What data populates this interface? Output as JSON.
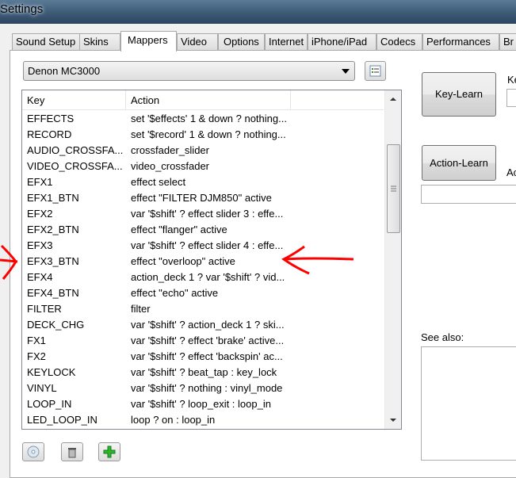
{
  "window": {
    "title": "Settings"
  },
  "tabs": [
    {
      "label": "Sound Setup"
    },
    {
      "label": "Skins"
    },
    {
      "label": "Mappers",
      "active": true
    },
    {
      "label": "Video"
    },
    {
      "label": "Options"
    },
    {
      "label": "Internet"
    },
    {
      "label": "iPhone/iPad"
    },
    {
      "label": "Codecs"
    },
    {
      "label": "Performances"
    },
    {
      "label": "Br"
    }
  ],
  "mapper": {
    "selected": "Denon MC3000"
  },
  "table": {
    "columns": [
      "Key",
      "Action"
    ],
    "rows": [
      {
        "key": "EFFECTS",
        "action": "set '$effects' 1 & down ? nothing..."
      },
      {
        "key": "RECORD",
        "action": "set '$record' 1 & down ? nothing..."
      },
      {
        "key": "AUDIO_CROSSFA...",
        "action": "crossfader_slider"
      },
      {
        "key": "VIDEO_CROSSFA...",
        "action": "video_crossfader"
      },
      {
        "key": "EFX1",
        "action": "effect select"
      },
      {
        "key": "EFX1_BTN",
        "action": "effect \"FILTER DJM850\" active"
      },
      {
        "key": "EFX2",
        "action": "var '$shift' ? effect slider 3 : effe..."
      },
      {
        "key": "EFX2_BTN",
        "action": "effect \"flanger\" active"
      },
      {
        "key": "EFX3",
        "action": "var '$shift' ? effect slider 4 : effe..."
      },
      {
        "key": "EFX3_BTN",
        "action": "effect \"overloop\" active"
      },
      {
        "key": "EFX4",
        "action": "action_deck 1 ? var '$shift' ? vid..."
      },
      {
        "key": "EFX4_BTN",
        "action": "effect \"echo\" active"
      },
      {
        "key": "FILTER",
        "action": "filter"
      },
      {
        "key": "DECK_CHG",
        "action": "var '$shift' ? action_deck 1 ? ski..."
      },
      {
        "key": "FX1",
        "action": "var '$shift' ? effect 'brake' active..."
      },
      {
        "key": "FX2",
        "action": "var '$shift' ? effect 'backspin' ac..."
      },
      {
        "key": "KEYLOCK",
        "action": "var '$shift' ? beat_tap : key_lock"
      },
      {
        "key": "VINYL",
        "action": "var '$shift' ? nothing : vinyl_mode"
      },
      {
        "key": "LOOP_IN",
        "action": "var '$shift' ? loop_exit : loop_in"
      },
      {
        "key": "LED_LOOP_IN",
        "action": "loop ? on : loop_in"
      }
    ]
  },
  "right": {
    "key_learn": "Key-Learn",
    "key_label": "Ke",
    "action_learn": "Action-Learn",
    "action_label": "Ac",
    "see_also": "See also:"
  },
  "annotation_color": "#ff0000"
}
